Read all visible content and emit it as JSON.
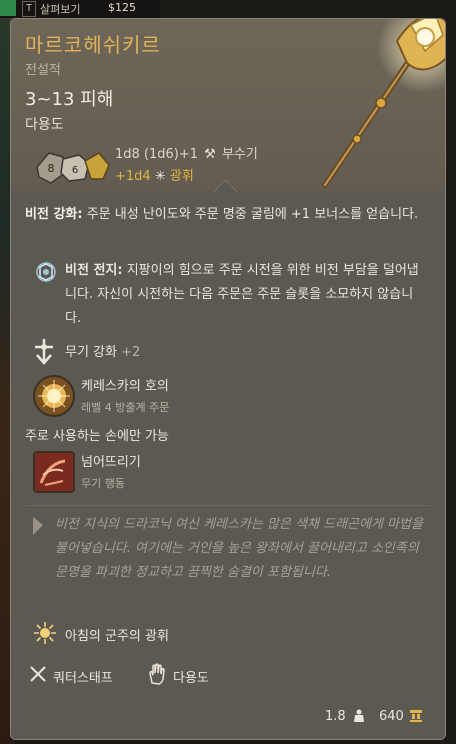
{
  "background": {
    "key_hint": "T",
    "label": "살펴보기",
    "value": "$125"
  },
  "item": {
    "name": "마르코헤쉬키르",
    "rarity": "전설적",
    "damage": "3~13 피해",
    "weapon_type": "다용도",
    "dice_values": [
      "8",
      "6"
    ],
    "damage_formula": "1d8 (1d6)+1",
    "damage_type": "부수기",
    "bonus_damage": "+1d4",
    "bonus_type": "광휘",
    "colors": {
      "name": "#e2b158",
      "bonus": "#e3b43e"
    }
  },
  "passive": {
    "name": "비전 강화:",
    "text": "주문 내성 난이도와 주문 명중 굴림에 +1 보너스를 얻습니다."
  },
  "arcane": {
    "icon": "arcane-battery-icon",
    "name": "비전 전지:",
    "text": "지팡이의 힘으로 주문 시전을 위한 비전 부담을 덜어냅니다. 자신이 시전하는 다음 주문은 주문 슬롯을 소모하지 않습니다."
  },
  "weapon_skill": {
    "label": "무기 강화",
    "bonus": "+2"
  },
  "spell": {
    "name": "케레스카의 호의",
    "subtitle": "레벨 4 방출계 주문"
  },
  "mainhand_note": "주로 사용하는 손에만 가능",
  "action": {
    "name": "넘어뜨리기",
    "subtitle": "무기 행동"
  },
  "lore": "비전 지식의 드라코닉 여신 케레스카는 많은 색채 드래곤에게 마법을 불어넣습니다. 여기에는 거인을 높은 왕좌에서 끌어내리고 소인족의 문명을 파괴한 정교하고 끔찍한 숨결이 포함됩니다.",
  "blessing": "아침의 군주의 광휘",
  "proficiency": {
    "weapon": "쿼터스태프",
    "category": "다용도"
  },
  "footer": {
    "weight": "1.8",
    "price": "640"
  }
}
